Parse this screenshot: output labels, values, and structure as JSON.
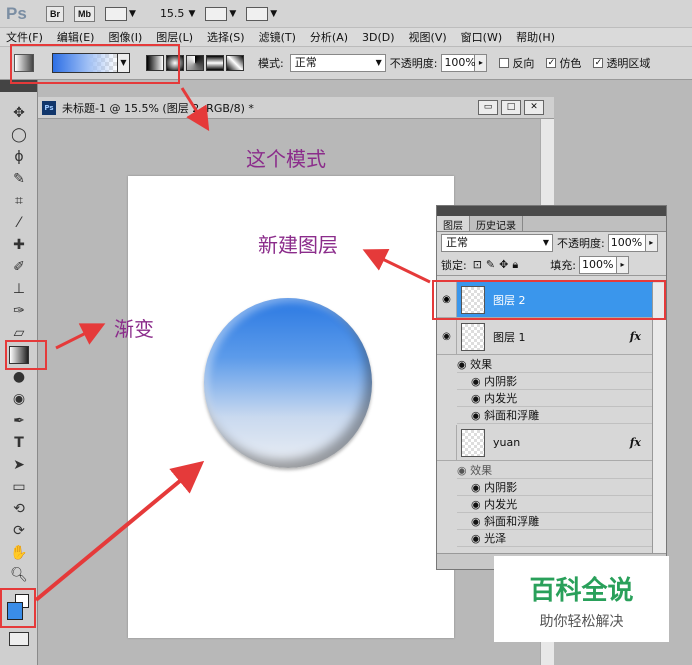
{
  "app": {
    "logo": "Ps",
    "bridge_btn": "Br",
    "minibridge_btn": "Mb",
    "zoom_value": "15.5"
  },
  "menu": [
    "文件(F)",
    "编辑(E)",
    "图像(I)",
    "图层(L)",
    "选择(S)",
    "滤镜(T)",
    "分析(A)",
    "3D(D)",
    "视图(V)",
    "窗口(W)",
    "帮助(H)"
  ],
  "options": {
    "mode_label": "模式:",
    "mode_value": "正常",
    "opacity_label": "不透明度:",
    "opacity_value": "100%",
    "reverse_label": "反向",
    "dither_label": "仿色",
    "transparency_label": "透明区域"
  },
  "document": {
    "title": "未标题-1 @ 15.5% (图层 2, RGB/8) *",
    "ps_badge": "Ps"
  },
  "layers_panel": {
    "tab_layers": "图层",
    "tab_history": "历史记录",
    "blend_mode": "正常",
    "opacity_label": "不透明度:",
    "opacity_value": "100%",
    "lock_label": "锁定:",
    "fill_label": "填充:",
    "fill_value": "100%",
    "layers": [
      {
        "name": "图层 2",
        "selected": true,
        "visible": true
      },
      {
        "name": "图层 1",
        "fx": "fx",
        "visible": true,
        "effects_label": "效果",
        "effects": [
          "内阴影",
          "内发光",
          "斜面和浮雕"
        ]
      },
      {
        "name": "yuan",
        "fx": "fx",
        "visible": false,
        "effects_label": "效果",
        "effects": [
          "内阴影",
          "内发光",
          "斜面和浮雕",
          "光泽"
        ]
      }
    ]
  },
  "annotations": {
    "mode_note": "这个模式",
    "new_layer_note": "新建图层",
    "gradient_note": "渐变"
  },
  "watermark": {
    "title": "百科全说",
    "subtitle": "助你轻松解决"
  },
  "colors": {
    "foreground": "#3a8de8",
    "background": "#ffffff",
    "selected_layer": "#3a96ec",
    "annotation_red": "#e53a3a",
    "annotation_text": "#8b2c8b",
    "watermark_green": "#29a05a"
  }
}
